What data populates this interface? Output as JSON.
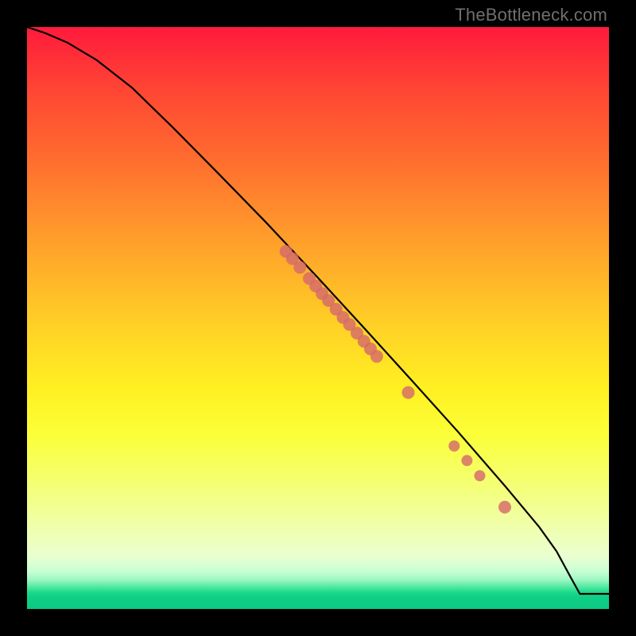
{
  "watermark": "TheBottleneck.com",
  "colors": {
    "dot": "#d66a6a",
    "curve": "#000000",
    "page_bg": "#000000"
  },
  "chart_data": {
    "type": "line",
    "title": "",
    "xlabel": "",
    "ylabel": "",
    "xlim": [
      0,
      100
    ],
    "ylim": [
      0,
      100
    ],
    "grid": false,
    "legend": false,
    "series": [
      {
        "name": "curve",
        "x": [
          0,
          3,
          7,
          12,
          18,
          25,
          33,
          41,
          50,
          58,
          66,
          74,
          82,
          88,
          91,
          93.5,
          95,
          100
        ],
        "y": [
          100,
          99,
          97.3,
          94.3,
          89.6,
          82.8,
          74.7,
          66.5,
          56.9,
          48.2,
          39.4,
          30.5,
          21.3,
          14.1,
          9.9,
          5.3,
          2.6,
          2.6
        ]
      }
    ],
    "scatter": [
      {
        "name": "dots",
        "points": [
          {
            "x_frac": 0.445,
            "y_frac": 0.3855,
            "r": 8
          },
          {
            "x_frac": 0.456,
            "y_frac": 0.398,
            "r": 8
          },
          {
            "x_frac": 0.469,
            "y_frac": 0.413,
            "r": 8
          },
          {
            "x_frac": 0.485,
            "y_frac": 0.432,
            "r": 8
          },
          {
            "x_frac": 0.496,
            "y_frac": 0.445,
            "r": 8
          },
          {
            "x_frac": 0.507,
            "y_frac": 0.458,
            "r": 8
          },
          {
            "x_frac": 0.518,
            "y_frac": 0.47,
            "r": 8
          },
          {
            "x_frac": 0.531,
            "y_frac": 0.485,
            "r": 8
          },
          {
            "x_frac": 0.543,
            "y_frac": 0.499,
            "r": 8
          },
          {
            "x_frac": 0.554,
            "y_frac": 0.511,
            "r": 8
          },
          {
            "x_frac": 0.567,
            "y_frac": 0.526,
            "r": 8
          },
          {
            "x_frac": 0.579,
            "y_frac": 0.54,
            "r": 8
          },
          {
            "x_frac": 0.59,
            "y_frac": 0.553,
            "r": 8
          },
          {
            "x_frac": 0.601,
            "y_frac": 0.566,
            "r": 8
          },
          {
            "x_frac": 0.655,
            "y_frac": 0.628,
            "r": 8
          },
          {
            "x_frac": 0.734,
            "y_frac": 0.72,
            "r": 7
          },
          {
            "x_frac": 0.756,
            "y_frac": 0.745,
            "r": 7
          },
          {
            "x_frac": 0.778,
            "y_frac": 0.771,
            "r": 7
          },
          {
            "x_frac": 0.821,
            "y_frac": 0.825,
            "r": 8
          }
        ]
      }
    ]
  }
}
